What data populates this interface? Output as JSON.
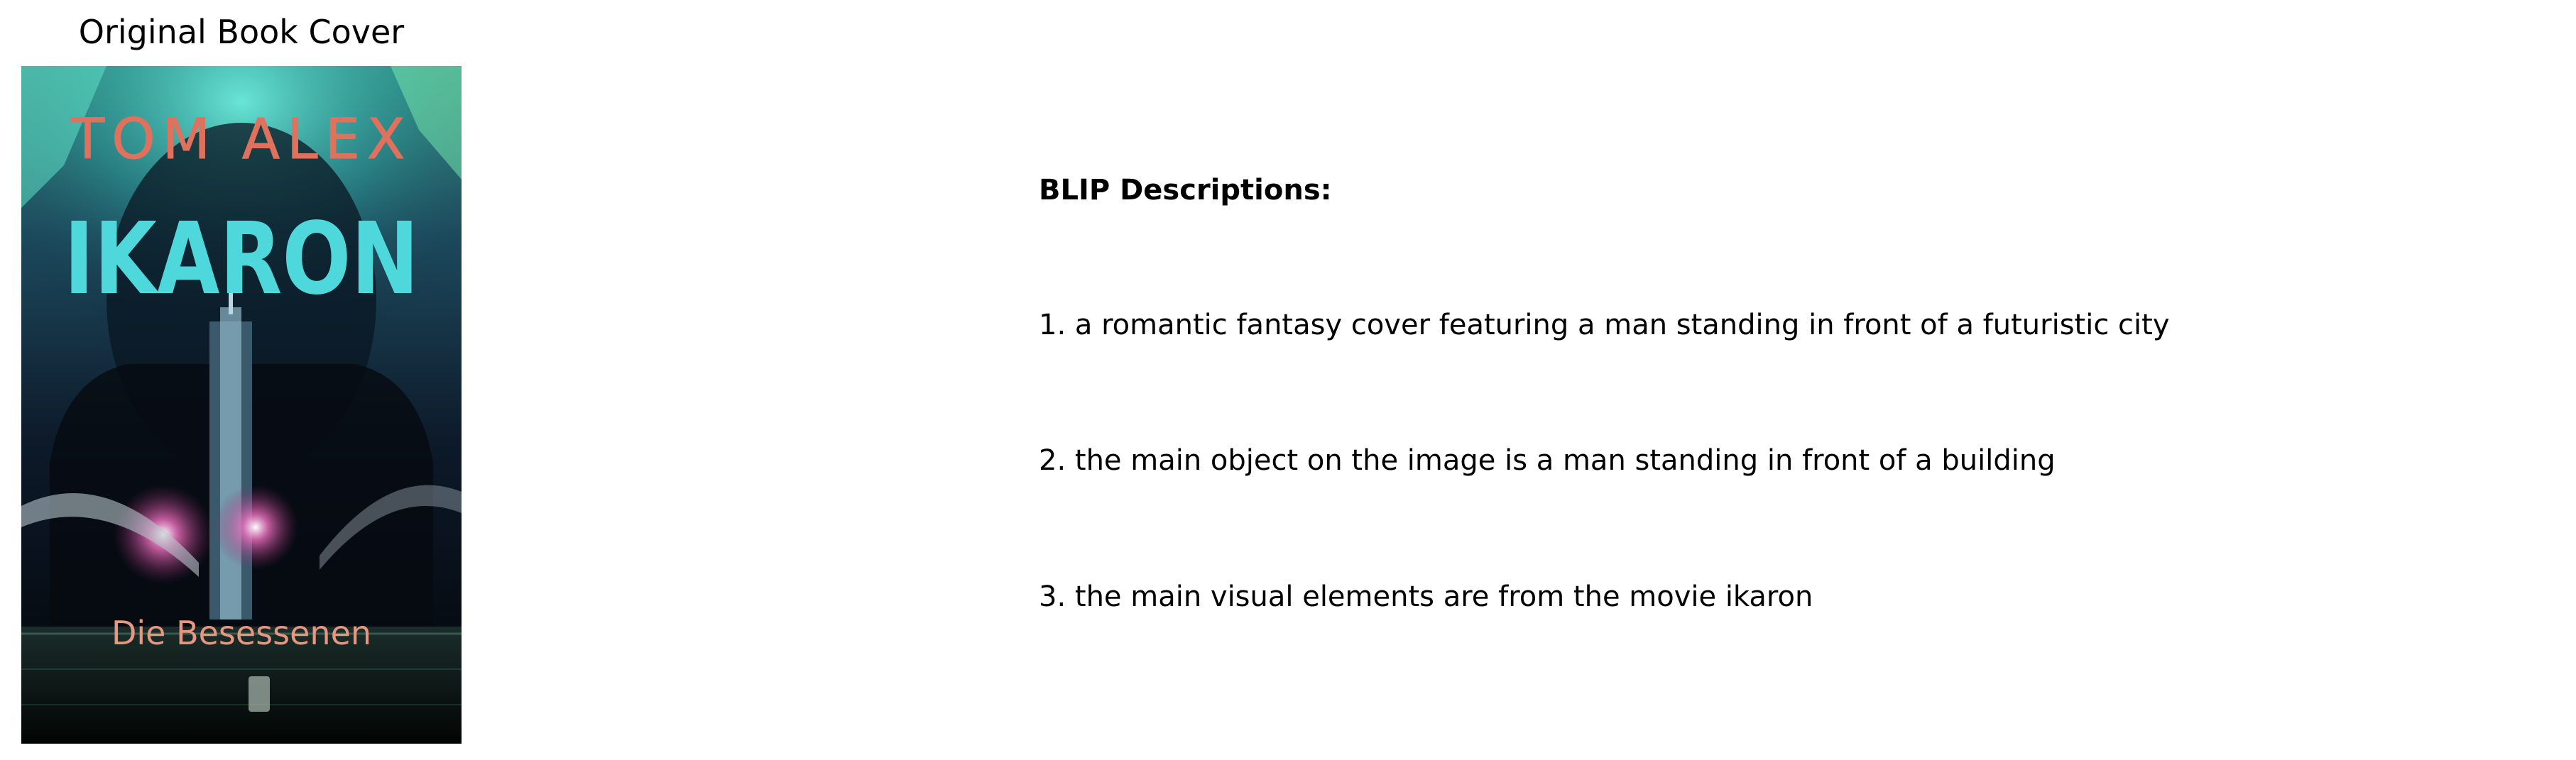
{
  "cover": {
    "heading": "Original Book Cover",
    "author": "TOM ALEX",
    "title": "IKARON",
    "subtitle": "Die Besessenen"
  },
  "descriptions": {
    "heading": "BLIP Descriptions:",
    "items": [
      "1. a romantic fantasy cover featuring a man standing in front of a futuristic city",
      "2. the main object on the image is a man standing in front of a building",
      "3. the main visual elements are from the movie ikaron"
    ]
  },
  "colors": {
    "author": "#e0715c",
    "title": "#4fd8dc",
    "subtitle": "#e7967f",
    "aurora": "#3fe0b0",
    "glow": "#e0408a"
  }
}
